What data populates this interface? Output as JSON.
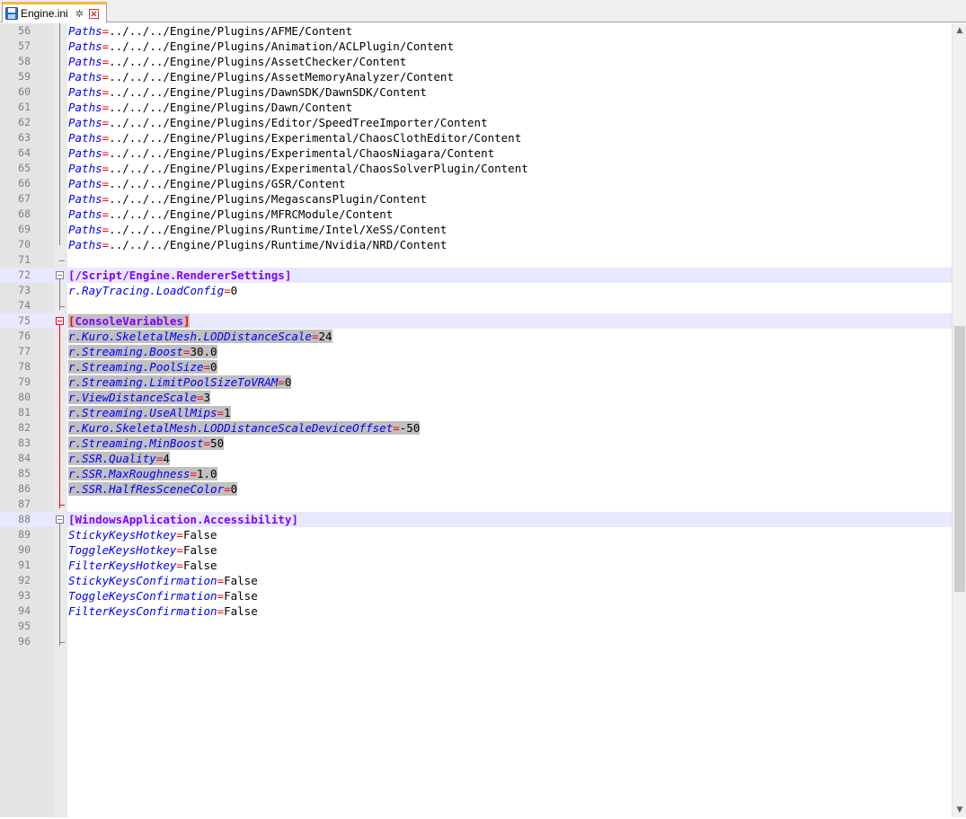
{
  "tab": {
    "label": "Engine.ini",
    "pin_glyph": "✲",
    "close_glyph": "✕"
  },
  "lines": [
    {
      "n": "56",
      "type": "kv",
      "key": "Paths",
      "value": "../../../Engine/Plugins/AFME/Content"
    },
    {
      "n": "57",
      "type": "kv",
      "key": "Paths",
      "value": "../../../Engine/Plugins/Animation/ACLPlugin/Content"
    },
    {
      "n": "58",
      "type": "kv",
      "key": "Paths",
      "value": "../../../Engine/Plugins/AssetChecker/Content"
    },
    {
      "n": "59",
      "type": "kv",
      "key": "Paths",
      "value": "../../../Engine/Plugins/AssetMemoryAnalyzer/Content"
    },
    {
      "n": "60",
      "type": "kv",
      "key": "Paths",
      "value": "../../../Engine/Plugins/DawnSDK/DawnSDK/Content"
    },
    {
      "n": "61",
      "type": "kv",
      "key": "Paths",
      "value": "../../../Engine/Plugins/Dawn/Content"
    },
    {
      "n": "62",
      "type": "kv",
      "key": "Paths",
      "value": "../../../Engine/Plugins/Editor/SpeedTreeImporter/Content"
    },
    {
      "n": "63",
      "type": "kv",
      "key": "Paths",
      "value": "../../../Engine/Plugins/Experimental/ChaosClothEditor/Content"
    },
    {
      "n": "64",
      "type": "kv",
      "key": "Paths",
      "value": "../../../Engine/Plugins/Experimental/ChaosNiagara/Content"
    },
    {
      "n": "65",
      "type": "kv",
      "key": "Paths",
      "value": "../../../Engine/Plugins/Experimental/ChaosSolverPlugin/Content"
    },
    {
      "n": "66",
      "type": "kv",
      "key": "Paths",
      "value": "../../../Engine/Plugins/GSR/Content"
    },
    {
      "n": "67",
      "type": "kv",
      "key": "Paths",
      "value": "../../../Engine/Plugins/MegascansPlugin/Content"
    },
    {
      "n": "68",
      "type": "kv",
      "key": "Paths",
      "value": "../../../Engine/Plugins/MFRCModule/Content"
    },
    {
      "n": "69",
      "type": "kv",
      "key": "Paths",
      "value": "../../../Engine/Plugins/Runtime/Intel/XeSS/Content"
    },
    {
      "n": "70",
      "type": "kv",
      "key": "Paths",
      "value": "../../../Engine/Plugins/Runtime/Nvidia/NRD/Content"
    },
    {
      "n": "71",
      "type": "blank"
    },
    {
      "n": "72",
      "type": "section",
      "text": "[/Script/Engine.RendererSettings]"
    },
    {
      "n": "73",
      "type": "kv",
      "key": "r.RayTracing.LoadConfig",
      "value": "0"
    },
    {
      "n": "74",
      "type": "blank"
    },
    {
      "n": "75",
      "type": "section",
      "text": "[ConsoleVariables]",
      "selected": true
    },
    {
      "n": "76",
      "type": "kv",
      "key": "r.Kuro.SkeletalMesh.LODDistanceScale",
      "value": "24",
      "selected": true
    },
    {
      "n": "77",
      "type": "kv",
      "key": "r.Streaming.Boost",
      "value": "30.0",
      "selected": true
    },
    {
      "n": "78",
      "type": "kv",
      "key": "r.Streaming.PoolSize",
      "value": "0",
      "selected": true
    },
    {
      "n": "79",
      "type": "kv",
      "key": "r.Streaming.LimitPoolSizeToVRAM",
      "value": "0",
      "selected": true
    },
    {
      "n": "80",
      "type": "kv",
      "key": "r.ViewDistanceScale",
      "value": "3",
      "selected": true
    },
    {
      "n": "81",
      "type": "kv",
      "key": "r.Streaming.UseAllMips",
      "value": "1",
      "selected": true
    },
    {
      "n": "82",
      "type": "kv",
      "key": "r.Kuro.SkeletalMesh.LODDistanceScaleDeviceOffset",
      "value": "-50",
      "selected": true
    },
    {
      "n": "83",
      "type": "kv",
      "key": "r.Streaming.MinBoost",
      "value": "50",
      "selected": true
    },
    {
      "n": "84",
      "type": "kv",
      "key": "r.SSR.Quality",
      "value": "4",
      "selected": true
    },
    {
      "n": "85",
      "type": "kv",
      "key": "r.SSR.MaxRoughness",
      "value": "1.0",
      "selected": true
    },
    {
      "n": "86",
      "type": "kv",
      "key": "r.SSR.HalfResSceneColor",
      "value": "0",
      "selected": true
    },
    {
      "n": "87",
      "type": "blank"
    },
    {
      "n": "88",
      "type": "section",
      "text": "[WindowsApplication.Accessibility]"
    },
    {
      "n": "89",
      "type": "kv",
      "key": "StickyKeysHotkey",
      "value": "False"
    },
    {
      "n": "90",
      "type": "kv",
      "key": "ToggleKeysHotkey",
      "value": "False"
    },
    {
      "n": "91",
      "type": "kv",
      "key": "FilterKeysHotkey",
      "value": "False"
    },
    {
      "n": "92",
      "type": "kv",
      "key": "StickyKeysConfirmation",
      "value": "False"
    },
    {
      "n": "93",
      "type": "kv",
      "key": "ToggleKeysConfirmation",
      "value": "False"
    },
    {
      "n": "94",
      "type": "kv",
      "key": "FilterKeysConfirmation",
      "value": "False"
    },
    {
      "n": "95",
      "type": "blank"
    },
    {
      "n": "96",
      "type": "blank"
    }
  ],
  "colors": {
    "key": "#0000ff",
    "equals": "#ff0000",
    "section": "#8000ff",
    "selection": "#c0c0c0",
    "current_line": "#e8e8ff",
    "fold_active": "#ff0000"
  }
}
